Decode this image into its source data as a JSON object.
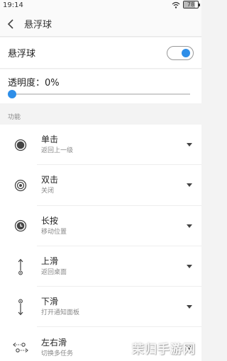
{
  "status_bar": {
    "time": "19:14",
    "battery": "78",
    "battery_level": 0.78
  },
  "header": {
    "title": "悬浮球"
  },
  "toggle_row": {
    "label": "悬浮球",
    "enabled": true
  },
  "opacity_row": {
    "label": "透明度：0%",
    "value_percent": 0
  },
  "section": {
    "label": "功能"
  },
  "functions": [
    {
      "title": "单击",
      "action": "返回上一级",
      "icon": "dot-circle-icon"
    },
    {
      "title": "双击",
      "action": "关闭",
      "icon": "double-ring-icon"
    },
    {
      "title": "长按",
      "action": "移动位置",
      "icon": "clock-icon"
    },
    {
      "title": "上滑",
      "action": "返回桌面",
      "icon": "swipe-up-icon"
    },
    {
      "title": "下滑",
      "action": "打开通知面板",
      "icon": "swipe-down-icon"
    },
    {
      "title": "左右滑",
      "action": "切换多任务",
      "icon": "swipe-horizontal-icon"
    }
  ],
  "watermark": "茉归手游网",
  "colors": {
    "accent": "#2e8ee8",
    "background": "#f3f3f3"
  }
}
